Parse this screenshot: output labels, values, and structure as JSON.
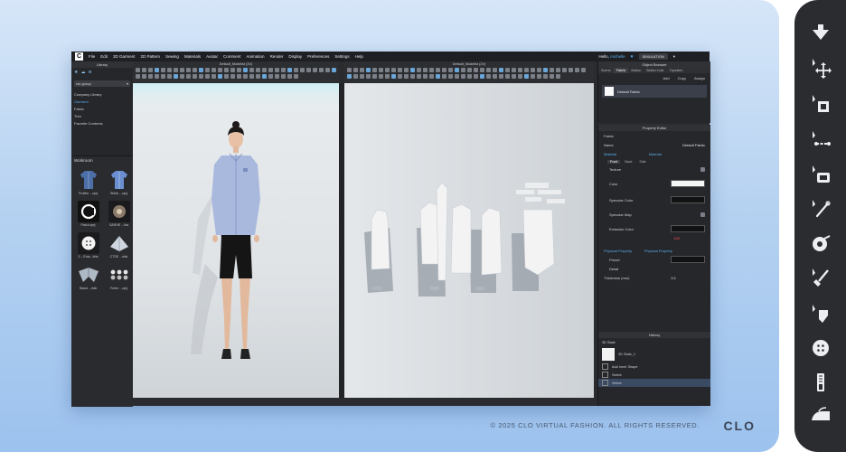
{
  "menu": {
    "logo": "C",
    "items": [
      "File",
      "Edit",
      "3D Garment",
      "2D Pattern",
      "Sewing",
      "Materials",
      "Avatar",
      "Comment",
      "Animation",
      "Render",
      "Display",
      "Preferences",
      "Settings",
      "Help"
    ],
    "greeting_prefix": "Hello, ",
    "greeting_user": "michelle",
    "simulation_label": "SIMULATION"
  },
  "library": {
    "title": "Library",
    "dropdown": "clo-group",
    "items": [
      "Company Library",
      "Garment",
      "Fabric",
      "Trim",
      "Favorite Contents"
    ],
    "active_index": 1
  },
  "workroom": {
    "title": "Workroom",
    "tiles": [
      {
        "label": "Fruiitm ...zprj",
        "icon": "shirt-icon"
      },
      {
        "label": "Shirts ...zprj",
        "icon": "shirt-icon"
      },
      {
        "label": "Patch.zprj",
        "icon": "logo-patch-icon"
      },
      {
        "label": "SASHE ...lha",
        "icon": "fabric-icon"
      },
      {
        "label": "3 ...Ems...bhe",
        "icon": "button-icon"
      },
      {
        "label": "CTSE ...rfab",
        "icon": "fabric-icon"
      },
      {
        "label": "Stand ...rfab",
        "icon": "fold-icon"
      },
      {
        "label": "Frelm ...zprj",
        "icon": "buttons-icon"
      }
    ]
  },
  "viewport3d": {
    "title": "Default_Modelist (3V)"
  },
  "viewport2d": {
    "title": "Default_Modelist (2V)"
  },
  "object_browser": {
    "title": "Object Browser",
    "tabs": [
      "Scene",
      "Fabric",
      "Button",
      "Button hole",
      "Topstitch"
    ],
    "active_tab": 1,
    "actions": [
      "Add",
      "Copy",
      "Assign"
    ],
    "fabric_name": "Default Fabric"
  },
  "property_editor": {
    "title": "Property Editor",
    "section": "Fabric",
    "name_label": "Name",
    "name_value": "Default Fabric",
    "material_label": "Material",
    "material_value": "Material",
    "subtabs": [
      "Front",
      "Back",
      "Side"
    ],
    "texture_label": "Texture",
    "color_label": "Color",
    "specular_color_label": "Specular Color",
    "specular_map_label": "Specular Map",
    "emission_color_label": "Emission Color",
    "emission_value": "100",
    "physical_label": "Physical Property",
    "physical_value": "Physical Property",
    "preset_label": "Preset",
    "detail_label": "Detail",
    "thickness_label": "Thickness (mm)",
    "thickness_value": "0.1"
  },
  "history": {
    "title": "History",
    "state_label": "3D State",
    "state_name": "3D State_1",
    "items": [
      "Add Inner Shape",
      "Select",
      "Select"
    ]
  },
  "footer": {
    "copyright": "© 2025 CLO VIRTUAL FASHION. ALL RIGHTS RESERVED.",
    "logo": "CLO"
  },
  "tool_strip": {
    "icons": [
      "arrow-down-icon",
      "move-tool-icon",
      "sewing-machine-icon",
      "measure-tool-icon",
      "sew-segment-icon",
      "needle-icon",
      "roll-tool-icon",
      "pin-brush-icon",
      "trim-tool-icon",
      "button-icon",
      "zipper-icon",
      "iron-icon"
    ]
  }
}
